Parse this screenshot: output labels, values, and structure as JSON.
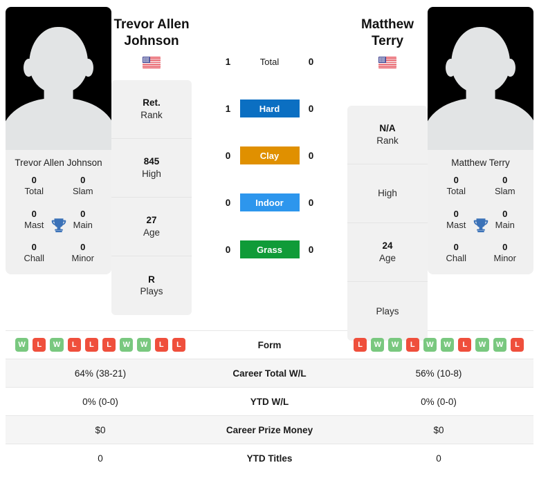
{
  "colors": {
    "hard": "#0b6fc2",
    "clay": "#e09000",
    "indoor": "#2d96ed",
    "grass": "#109b38",
    "win_badge": "#79c87f",
    "loss_badge": "#ef4f3c",
    "trophy": "#3b72b8"
  },
  "left_player": {
    "full_name_line1": "Trevor Allen",
    "full_name_line2": "Johnson",
    "photo_caption": "Trevor Allen Johnson",
    "country_flag": "us-flag-icon",
    "titles": [
      {
        "value": "0",
        "label": "Total"
      },
      {
        "value": "0",
        "label": "Slam"
      },
      {
        "value": "0",
        "label": "Mast"
      },
      {
        "value": "0",
        "label": "Main"
      },
      {
        "value": "0",
        "label": "Chall"
      },
      {
        "value": "0",
        "label": "Minor"
      }
    ],
    "info": [
      {
        "value": "Ret.",
        "label": "Rank"
      },
      {
        "value": "845",
        "label": "High"
      },
      {
        "value": "27",
        "label": "Age"
      },
      {
        "value": "R",
        "label": "Plays"
      }
    ],
    "form": [
      "W",
      "L",
      "W",
      "L",
      "L",
      "L",
      "W",
      "W",
      "L",
      "L"
    ]
  },
  "right_player": {
    "full_name_line1": "Matthew",
    "full_name_line2": "Terry",
    "photo_caption": "Matthew Terry",
    "country_flag": "us-flag-icon",
    "titles": [
      {
        "value": "0",
        "label": "Total"
      },
      {
        "value": "0",
        "label": "Slam"
      },
      {
        "value": "0",
        "label": "Mast"
      },
      {
        "value": "0",
        "label": "Main"
      },
      {
        "value": "0",
        "label": "Chall"
      },
      {
        "value": "0",
        "label": "Minor"
      }
    ],
    "info": [
      {
        "value": "N/A",
        "label": "Rank"
      },
      {
        "value": "",
        "label": "High"
      },
      {
        "value": "24",
        "label": "Age"
      },
      {
        "value": "",
        "label": "Plays"
      }
    ],
    "form": [
      "L",
      "W",
      "W",
      "L",
      "W",
      "W",
      "L",
      "W",
      "W",
      "L"
    ]
  },
  "surfaces": [
    {
      "label": "Total",
      "left": "1",
      "right": "0",
      "style": "plain"
    },
    {
      "label": "Hard",
      "left": "1",
      "right": "0",
      "style": "hard"
    },
    {
      "label": "Clay",
      "left": "0",
      "right": "0",
      "style": "clay"
    },
    {
      "label": "Indoor",
      "left": "0",
      "right": "0",
      "style": "indoor"
    },
    {
      "label": "Grass",
      "left": "0",
      "right": "0",
      "style": "grass"
    }
  ],
  "stats_rows": [
    {
      "label": "Form",
      "left": "",
      "right": "",
      "kind": "form"
    },
    {
      "label": "Career Total W/L",
      "left": "64% (38-21)",
      "right": "56% (10-8)",
      "kind": "text"
    },
    {
      "label": "YTD W/L",
      "left": "0% (0-0)",
      "right": "0% (0-0)",
      "kind": "text"
    },
    {
      "label": "Career Prize Money",
      "left": "$0",
      "right": "$0",
      "kind": "text"
    },
    {
      "label": "YTD Titles",
      "left": "0",
      "right": "0",
      "kind": "text"
    }
  ]
}
